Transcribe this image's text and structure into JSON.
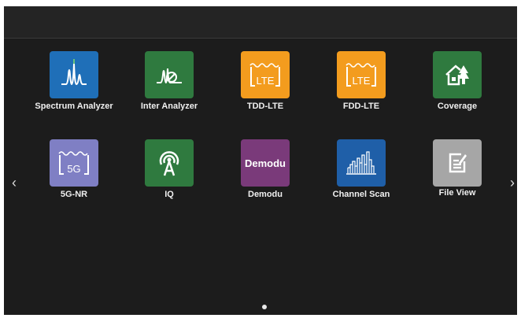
{
  "apps": [
    {
      "label": "Spectrum Analyzer",
      "icon": "spectrum-icon",
      "color": "#1f6fb8"
    },
    {
      "label": "Inter Analyzer",
      "icon": "interference-icon",
      "color": "#2f7a3f"
    },
    {
      "label": "TDD-LTE",
      "icon": "lte-icon",
      "color": "#f39c1e",
      "badge": "LTE"
    },
    {
      "label": "FDD-LTE",
      "icon": "lte-icon",
      "color": "#f39c1e",
      "badge": "LTE"
    },
    {
      "label": "Coverage",
      "icon": "house-tree-icon",
      "color": "#2f7a3f"
    },
    {
      "label": "5G-NR",
      "icon": "5g-icon",
      "color": "#7f7fc4",
      "badge": "5G"
    },
    {
      "label": "IQ",
      "icon": "antenna-icon",
      "color": "#2f7a3f"
    },
    {
      "label": "Demodu",
      "icon": "demodu-icon",
      "color": "#7a3a7a",
      "badge": "Demodu"
    },
    {
      "label": "Channel Scan",
      "icon": "channel-scan-icon",
      "color": "#1f5fa8"
    },
    {
      "label": "File View",
      "icon": "file-edit-icon",
      "color": "#a6a6a6"
    }
  ],
  "navigation": {
    "prev_symbol": "‹",
    "next_symbol": "›"
  },
  "pagination": {
    "pages": 1,
    "current": 1
  }
}
